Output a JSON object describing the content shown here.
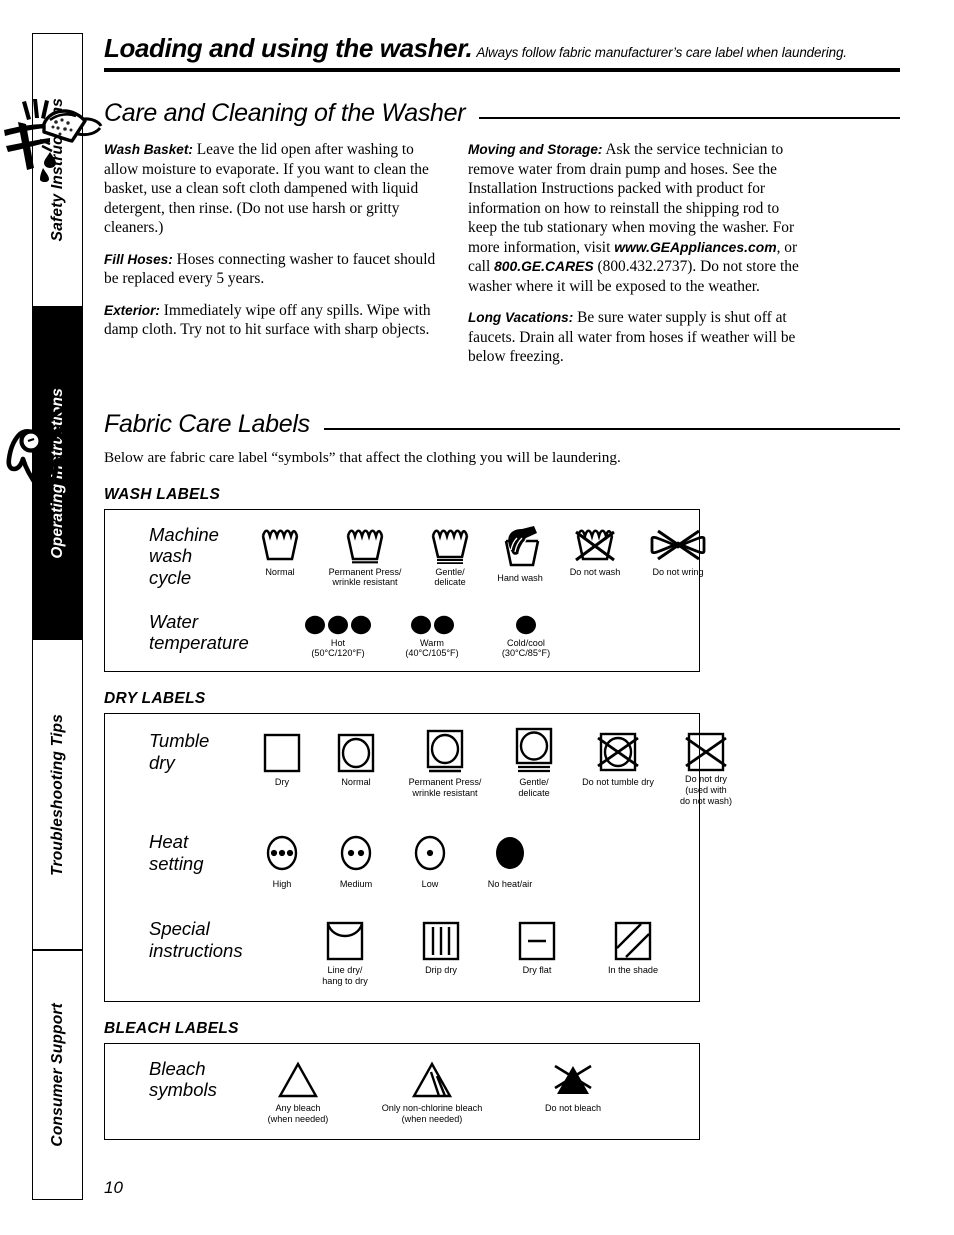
{
  "sidebar": {
    "tabs": [
      {
        "label": "Safety Instructions",
        "active": false
      },
      {
        "label": "Operating Instructions",
        "active": true
      },
      {
        "label": "Troubleshooting Tips",
        "active": false
      },
      {
        "label": "Consumer Support",
        "active": false
      }
    ]
  },
  "banner": {
    "title": "Loading and using the washer.",
    "subtitle": "Always follow fabric manufacturer’s care label when laundering."
  },
  "care": {
    "heading": "Care and Cleaning of the Washer",
    "icon": "sponge-cleaning-icon",
    "left_column": [
      {
        "lead": "Wash Basket:",
        "body": " Leave the lid open after washing to allow moisture to evaporate. If you want to clean the basket, use a clean soft cloth dampened with liquid detergent, then rinse.  (Do not use harsh or gritty cleaners.)"
      },
      {
        "lead": "Fill Hoses:",
        "body": " Hoses connecting washer to faucet should be replaced every 5 years."
      },
      {
        "lead": "Exterior:",
        "body": " Immediately wipe off any spills. Wipe with damp cloth. Try not to hit surface with sharp objects."
      }
    ],
    "right_column": [
      {
        "lead": "Moving and Storage:",
        "body_1": " Ask the service technician to remove water from drain pump and hoses.  See the Installation Instructions packed with product for information on how to reinstall the shipping rod to keep the tub stationary when moving the washer. For more information, visit ",
        "website": "www.GEAppliances.com",
        "body_2": ", or call ",
        "phone_word": "800.GE.CARES",
        "body_3": " (800.432.2737). Do not store the washer where it will be exposed to the weather."
      },
      {
        "lead": "Long Vacations:",
        "body": " Be sure water supply is shut off at faucets. Drain all water from hoses if weather will be below freezing."
      }
    ]
  },
  "fabric": {
    "heading": "Fabric Care Labels",
    "icon": "shirt-garment-icon",
    "intro": "Below are fabric care label “symbols” that affect the clothing you will be laundering.",
    "wash": {
      "group_label": "WASH LABELS",
      "rows": [
        {
          "label": "Machine\nwash\ncycle",
          "cells": [
            {
              "icon": "wash-tub-icon",
              "caption": "Normal"
            },
            {
              "icon": "wash-tub-one-bar-icon",
              "caption": "Permanent Press/\nwrinkle resistant"
            },
            {
              "icon": "wash-tub-two-bar-icon",
              "caption": "Gentle/\ndelicate"
            },
            {
              "icon": "hand-wash-icon",
              "caption": "Hand wash"
            },
            {
              "icon": "do-not-wash-icon",
              "caption": "Do not wash"
            },
            {
              "icon": "do-not-wring-icon",
              "caption": "Do not wring"
            }
          ]
        },
        {
          "label": "Water\ntemperature",
          "cells": [
            {
              "icon": "three-dots-icon",
              "dots": 3,
              "caption": "Hot\n(50°C/120°F)"
            },
            {
              "icon": "two-dots-icon",
              "dots": 2,
              "caption": "Warm\n(40°C/105°F)"
            },
            {
              "icon": "one-dot-icon",
              "dots": 1,
              "caption": "Cold/cool\n(30°C/85°F)"
            }
          ]
        }
      ]
    },
    "dry": {
      "group_label": "DRY LABELS",
      "rows": [
        {
          "label": "Tumble\ndry",
          "cells": [
            {
              "icon": "square-icon",
              "caption": "Dry"
            },
            {
              "icon": "tumble-dry-circle-icon",
              "caption": "Normal"
            },
            {
              "icon": "tumble-dry-one-bar-icon",
              "caption": "Permanent Press/\nwrinkle resistant"
            },
            {
              "icon": "tumble-dry-two-bar-icon",
              "caption": "Gentle/\ndelicate"
            },
            {
              "icon": "do-not-tumble-dry-icon",
              "caption": "Do not tumble dry"
            },
            {
              "icon": "do-not-dry-icon",
              "caption": "Do not dry\n(used with\ndo not wash)"
            }
          ]
        },
        {
          "label": "Heat\nsetting",
          "cells": [
            {
              "icon": "circle-three-dots-icon",
              "dots": 3,
              "caption": "High"
            },
            {
              "icon": "circle-two-dots-icon",
              "dots": 2,
              "caption": "Medium"
            },
            {
              "icon": "circle-one-dot-icon",
              "dots": 1,
              "caption": "Low"
            },
            {
              "icon": "filled-circle-icon",
              "dots": 0,
              "caption": "No heat/air"
            }
          ]
        },
        {
          "label": "Special\ninstructions",
          "cells": [
            {
              "icon": "line-dry-icon",
              "caption": "Line dry/\nhang to dry"
            },
            {
              "icon": "drip-dry-icon",
              "caption": "Drip dry"
            },
            {
              "icon": "dry-flat-icon",
              "caption": "Dry flat"
            },
            {
              "icon": "in-the-shade-icon",
              "caption": "In the shade"
            }
          ]
        }
      ]
    },
    "bleach": {
      "group_label": "BLEACH LABELS",
      "rows": [
        {
          "label": "Bleach\nsymbols",
          "cells": [
            {
              "icon": "any-bleach-triangle-icon",
              "caption": "Any bleach\n(when needed)"
            },
            {
              "icon": "non-chlorine-bleach-icon",
              "caption": "Only non-chlorine bleach\n(when needed)"
            },
            {
              "icon": "do-not-bleach-icon",
              "caption": "Do not bleach"
            }
          ]
        }
      ]
    }
  },
  "folio": "10"
}
